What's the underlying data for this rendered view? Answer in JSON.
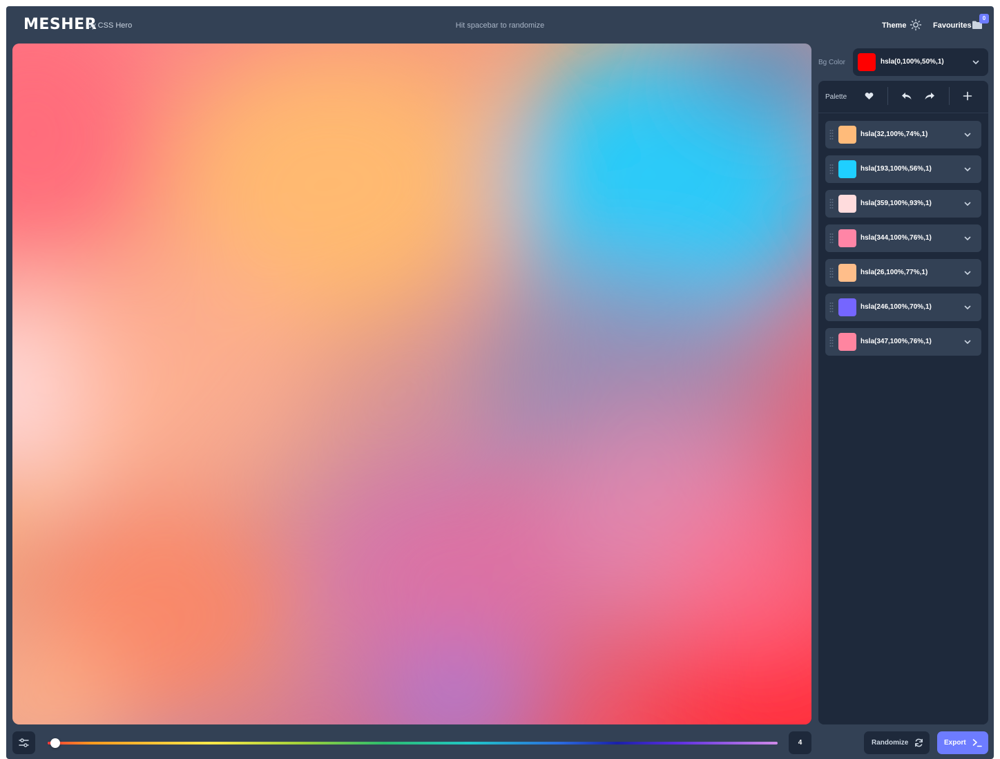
{
  "header": {
    "logo": "MESHER",
    "byline": "by CSS Hero",
    "hint": "Hit spacebar to randomize",
    "theme_label": "Theme",
    "favourites_label": "Favourites",
    "favourites_count": "0"
  },
  "bg_color": {
    "label": "Bg Color",
    "value": "hsla(0,100%,50%,1)",
    "swatch": "#ff0000"
  },
  "palette": {
    "label": "Palette",
    "colors": [
      {
        "value": "hsla(32,100%,74%,1)",
        "swatch": "#ffbb7a"
      },
      {
        "value": "hsla(193,100%,56%,1)",
        "swatch": "#1fcfff"
      },
      {
        "value": "hsla(359,100%,93%,1)",
        "swatch": "#ffdcdd"
      },
      {
        "value": "hsla(344,100%,76%,1)",
        "swatch": "#ff85a6"
      },
      {
        "value": "hsla(26,100%,77%,1)",
        "swatch": "#ffbe8a"
      },
      {
        "value": "hsla(246,100%,70%,1)",
        "swatch": "#7566ff"
      },
      {
        "value": "hsla(347,100%,76%,1)",
        "swatch": "#ff85a0"
      }
    ]
  },
  "bottom": {
    "count": "4",
    "randomize_label": "Randomize",
    "export_label": "Export"
  },
  "colors": {
    "accent": "#6d7cff",
    "panel": "#1e293b",
    "app_bg": "#334155"
  }
}
